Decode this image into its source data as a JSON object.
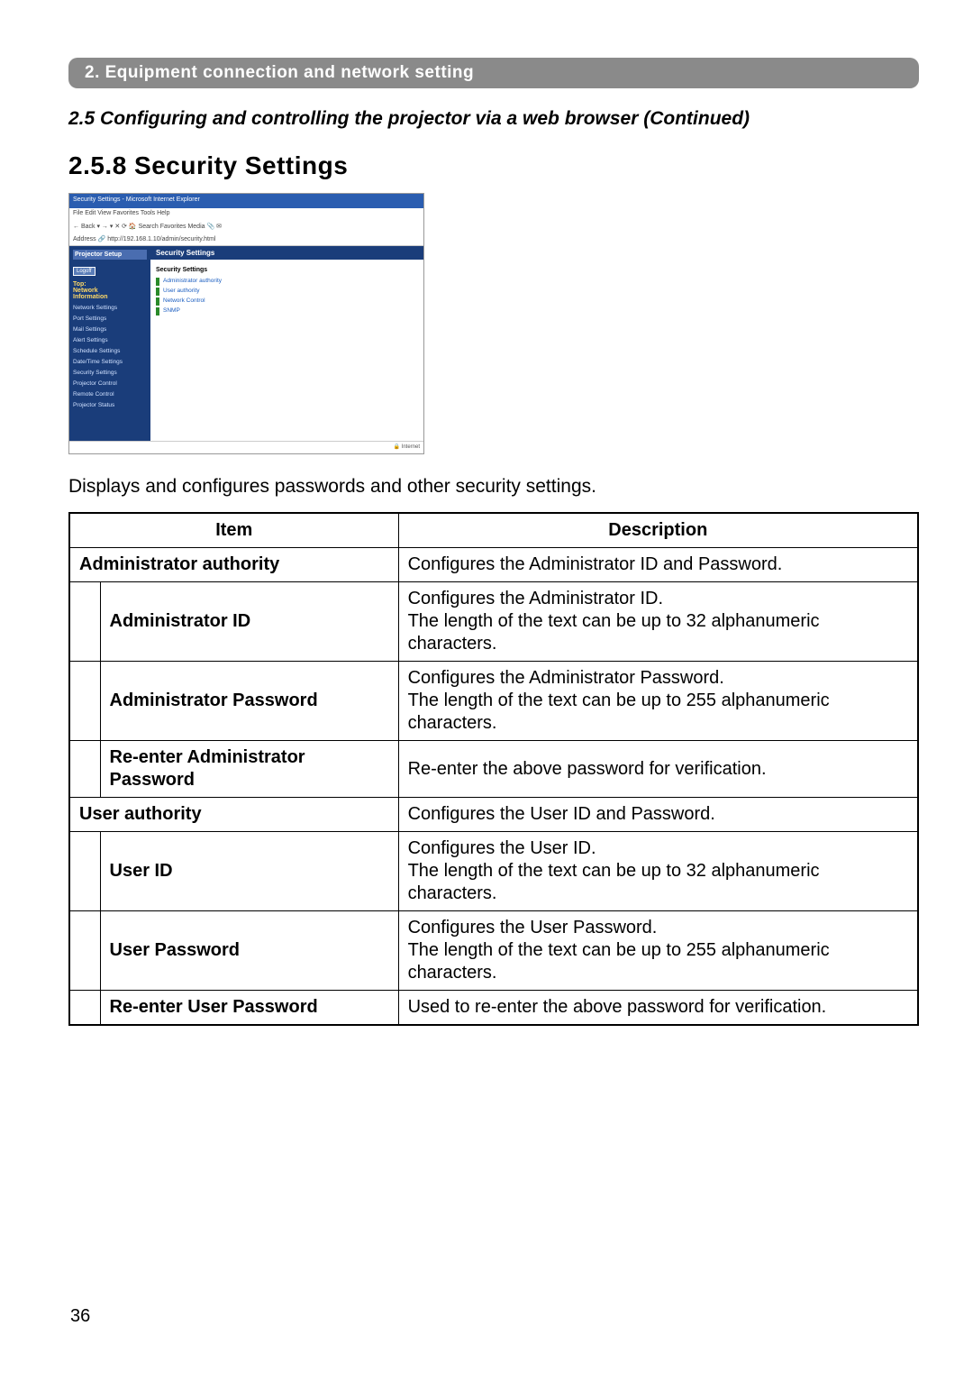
{
  "banner": "2. Equipment connection and network setting",
  "subtitle": "2.5 Configuring and controlling the projector via a web browser (Continued)",
  "sectionHeading": "2.5.8 Security Settings",
  "intro": "Displays and configures passwords and other security settings.",
  "tableHeaders": {
    "item": "Item",
    "description": "Description"
  },
  "rows": {
    "adminAuth": {
      "item": "Administrator authority",
      "desc": "Configures the Administrator ID and Password."
    },
    "adminId": {
      "item": "Administrator ID",
      "desc": "Configures the Administrator ID.\nThe length of the text can be up to 32 alphanumeric characters."
    },
    "adminPw": {
      "item": "Administrator Password",
      "desc": "Configures the Administrator Password.\nThe length of the text can be up to 255 alphanumeric characters."
    },
    "adminPw2": {
      "item": "Re-enter Administrator Password",
      "desc": "Re-enter the above password for verification."
    },
    "userAuth": {
      "item": "User authority",
      "desc": "Configures the User ID and Password."
    },
    "userId": {
      "item": "User ID",
      "desc": "Configures the User ID.\nThe length of the text can be up to 32 alphanumeric characters."
    },
    "userPw": {
      "item": "User Password",
      "desc": "Configures the User Password.\nThe length of the text can be up to 255 alphanumeric characters."
    },
    "userPw2": {
      "item": "Re-enter User Password",
      "desc": "Used to re-enter the above password for verification."
    }
  },
  "shot": {
    "title": "Security Settings - Microsoft Internet Explorer",
    "menu": "File  Edit  View  Favorites  Tools  Help",
    "toolbar": "← Back ▾ → ▾ ✕ ⟳ 🏠 Search  Favorites  Media 📎 ✉",
    "addr": "Address 🔗 http://192.168.1.10/admin/security.html",
    "setup": "Projector Setup",
    "logoff": "Logoff",
    "top": "Top:",
    "network": "Network",
    "information": "Information",
    "nav": [
      "Network Settings",
      "Port Settings",
      "Mail Settings",
      "Alert Settings",
      "Schedule Settings",
      "Date/Time Settings",
      "Security Settings",
      "Projector Control",
      "Remote Control",
      "Projector Status"
    ],
    "mainHeader": "Security Settings",
    "secTitle": "Security Settings",
    "mainRows": [
      "Administrator authority",
      "User authority",
      "Network Control",
      "SNMP"
    ]
  },
  "pageNumber": "36"
}
